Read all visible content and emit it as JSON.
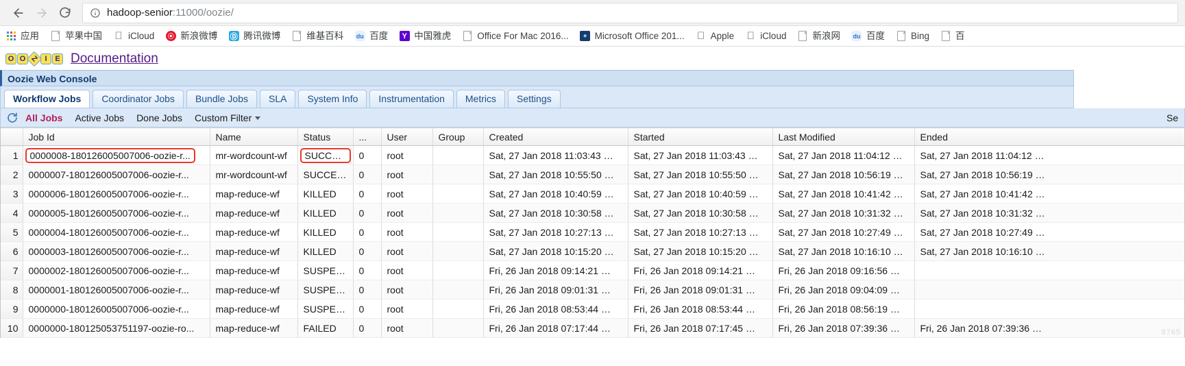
{
  "browser": {
    "back_icon": "back-arrow-icon",
    "forward_icon": "forward-arrow-icon",
    "reload_icon": "reload-icon",
    "info_icon": "info-circle-icon",
    "url_host": "hadoop-senior",
    "url_rest": ":11000/oozie/",
    "url_full": "hadoop-senior:11000/oozie/"
  },
  "bookmarks": [
    {
      "label": "应用",
      "icon": "apps-grid-icon"
    },
    {
      "label": "苹果中国",
      "icon": "document-icon"
    },
    {
      "label": "iCloud",
      "icon": "apple-icon"
    },
    {
      "label": "新浪微博",
      "icon": "weibo-icon"
    },
    {
      "label": "腾讯微博",
      "icon": "tencent-weibo-icon"
    },
    {
      "label": "维基百科",
      "icon": "document-icon"
    },
    {
      "label": "百度",
      "icon": "baidu-icon"
    },
    {
      "label": "中国雅虎",
      "icon": "yahoo-icon"
    },
    {
      "label": "Office For Mac 2016...",
      "icon": "document-icon"
    },
    {
      "label": "Microsoft Office 201...",
      "icon": "ms-office-icon"
    },
    {
      "label": "Apple",
      "icon": "apple-icon"
    },
    {
      "label": "iCloud",
      "icon": "apple-icon"
    },
    {
      "label": "新浪网",
      "icon": "document-icon"
    },
    {
      "label": "百度",
      "icon": "baidu-icon"
    },
    {
      "label": "Bing",
      "icon": "document-icon"
    },
    {
      "label": "百",
      "icon": "document-icon"
    }
  ],
  "oozie": {
    "logo_letters": [
      "O",
      "O",
      "Z",
      "I",
      "E"
    ],
    "doc_link": "Documentation",
    "console_title": "Oozie Web Console",
    "tabs": [
      {
        "label": "Workflow Jobs",
        "active": true
      },
      {
        "label": "Coordinator Jobs",
        "active": false
      },
      {
        "label": "Bundle Jobs",
        "active": false
      },
      {
        "label": "SLA",
        "active": false
      },
      {
        "label": "System Info",
        "active": false
      },
      {
        "label": "Instrumentation",
        "active": false
      },
      {
        "label": "Metrics",
        "active": false
      },
      {
        "label": "Settings",
        "active": false
      }
    ],
    "filters": [
      {
        "label": "All Jobs",
        "active": true
      },
      {
        "label": "Active Jobs",
        "active": false
      },
      {
        "label": "Done Jobs",
        "active": false
      },
      {
        "label": "Custom Filter",
        "active": false,
        "has_caret": true
      }
    ],
    "refresh_icon": "refresh-icon",
    "search_label_clipped": "Se"
  },
  "table": {
    "columns": [
      "",
      "Job Id",
      "Name",
      "Status",
      "...",
      "User",
      "Group",
      "Created",
      "Started",
      "Last Modified",
      "Ended"
    ],
    "rows": [
      {
        "idx": "1",
        "job_id": "0000008-180126005007006-oozie-r...",
        "name": "mr-wordcount-wf",
        "status": "SUCCE…",
        "dots": "0",
        "user": "root",
        "group": "",
        "created": "Sat, 27 Jan 2018 11:03:43 …",
        "started": "Sat, 27 Jan 2018 11:03:43 …",
        "last_modified": "Sat, 27 Jan 2018 11:04:12 …",
        "ended": "Sat, 27 Jan 2018 11:04:12 …",
        "highlight_job_id": true,
        "highlight_status": true
      },
      {
        "idx": "2",
        "job_id": "0000007-180126005007006-oozie-r...",
        "name": "mr-wordcount-wf",
        "status": "SUCCE…",
        "dots": "0",
        "user": "root",
        "group": "",
        "created": "Sat, 27 Jan 2018 10:55:50 …",
        "started": "Sat, 27 Jan 2018 10:55:50 …",
        "last_modified": "Sat, 27 Jan 2018 10:56:19 …",
        "ended": "Sat, 27 Jan 2018 10:56:19 …",
        "highlight_job_id": false,
        "highlight_status": false
      },
      {
        "idx": "3",
        "job_id": "0000006-180126005007006-oozie-r...",
        "name": "map-reduce-wf",
        "status": "KILLED",
        "dots": "0",
        "user": "root",
        "group": "",
        "created": "Sat, 27 Jan 2018 10:40:59 …",
        "started": "Sat, 27 Jan 2018 10:40:59 …",
        "last_modified": "Sat, 27 Jan 2018 10:41:42 …",
        "ended": "Sat, 27 Jan 2018 10:41:42 …",
        "highlight_job_id": false,
        "highlight_status": false
      },
      {
        "idx": "4",
        "job_id": "0000005-180126005007006-oozie-r...",
        "name": "map-reduce-wf",
        "status": "KILLED",
        "dots": "0",
        "user": "root",
        "group": "",
        "created": "Sat, 27 Jan 2018 10:30:58 …",
        "started": "Sat, 27 Jan 2018 10:30:58 …",
        "last_modified": "Sat, 27 Jan 2018 10:31:32 …",
        "ended": "Sat, 27 Jan 2018 10:31:32 …",
        "highlight_job_id": false,
        "highlight_status": false
      },
      {
        "idx": "5",
        "job_id": "0000004-180126005007006-oozie-r...",
        "name": "map-reduce-wf",
        "status": "KILLED",
        "dots": "0",
        "user": "root",
        "group": "",
        "created": "Sat, 27 Jan 2018 10:27:13 …",
        "started": "Sat, 27 Jan 2018 10:27:13 …",
        "last_modified": "Sat, 27 Jan 2018 10:27:49 …",
        "ended": "Sat, 27 Jan 2018 10:27:49 …",
        "highlight_job_id": false,
        "highlight_status": false
      },
      {
        "idx": "6",
        "job_id": "0000003-180126005007006-oozie-r...",
        "name": "map-reduce-wf",
        "status": "KILLED",
        "dots": "0",
        "user": "root",
        "group": "",
        "created": "Sat, 27 Jan 2018 10:15:20 …",
        "started": "Sat, 27 Jan 2018 10:15:20 …",
        "last_modified": "Sat, 27 Jan 2018 10:16:10 …",
        "ended": "Sat, 27 Jan 2018 10:16:10 …",
        "highlight_job_id": false,
        "highlight_status": false
      },
      {
        "idx": "7",
        "job_id": "0000002-180126005007006-oozie-r...",
        "name": "map-reduce-wf",
        "status": "SUSPE…",
        "dots": "0",
        "user": "root",
        "group": "",
        "created": "Fri, 26 Jan 2018 09:14:21 …",
        "started": "Fri, 26 Jan 2018 09:14:21 …",
        "last_modified": "Fri, 26 Jan 2018 09:16:56 …",
        "ended": "",
        "highlight_job_id": false,
        "highlight_status": false
      },
      {
        "idx": "8",
        "job_id": "0000001-180126005007006-oozie-r...",
        "name": "map-reduce-wf",
        "status": "SUSPE…",
        "dots": "0",
        "user": "root",
        "group": "",
        "created": "Fri, 26 Jan 2018 09:01:31 …",
        "started": "Fri, 26 Jan 2018 09:01:31 …",
        "last_modified": "Fri, 26 Jan 2018 09:04:09 …",
        "ended": "",
        "highlight_job_id": false,
        "highlight_status": false
      },
      {
        "idx": "9",
        "job_id": "0000000-180126005007006-oozie-r...",
        "name": "map-reduce-wf",
        "status": "SUSPE…",
        "dots": "0",
        "user": "root",
        "group": "",
        "created": "Fri, 26 Jan 2018 08:53:44 …",
        "started": "Fri, 26 Jan 2018 08:53:44 …",
        "last_modified": "Fri, 26 Jan 2018 08:56:19 …",
        "ended": "",
        "highlight_job_id": false,
        "highlight_status": false
      },
      {
        "idx": "10",
        "job_id": "0000000-180125053751197-oozie-ro...",
        "name": "map-reduce-wf",
        "status": "FAILED",
        "dots": "0",
        "user": "root",
        "group": "",
        "created": "Fri, 26 Jan 2018 07:17:44 …",
        "started": "Fri, 26 Jan 2018 07:17:45 …",
        "last_modified": "Fri, 26 Jan 2018 07:39:36 …",
        "ended": "Fri, 26 Jan 2018 07:39:36 …",
        "highlight_job_id": false,
        "highlight_status": false
      }
    ]
  },
  "watermark": "8765",
  "colors": {
    "accent": "#b2215b",
    "link": "#551a8b",
    "highlight": "#e8382c",
    "panel": "#dbe8f7"
  }
}
